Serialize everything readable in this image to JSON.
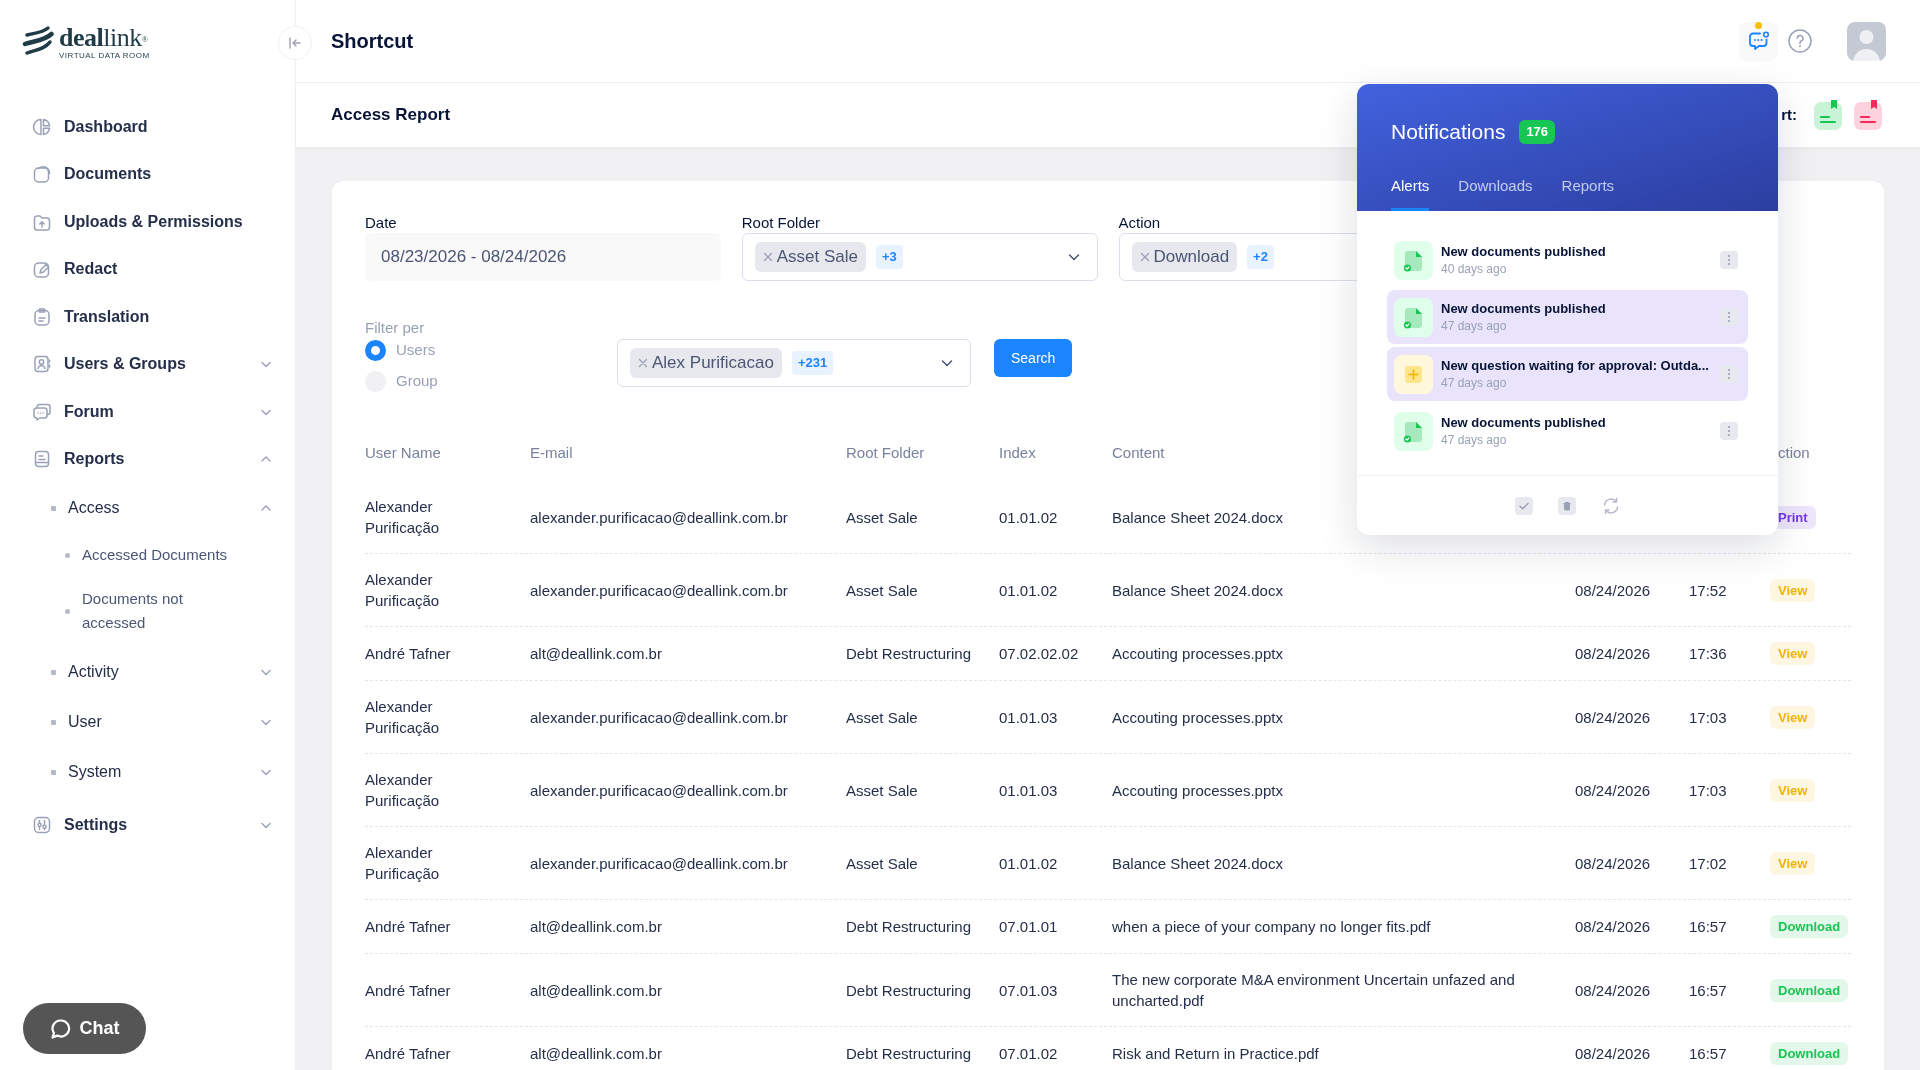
{
  "logo": {
    "wordmark": "**deal**link$^{®}$",
    "tagline": "VIRTUAL DATA ROOM"
  },
  "sidebar": {
    "items": [
      {
        "label": "Dashboard"
      },
      {
        "label": "Documents"
      },
      {
        "label": "Uploads & Permissions"
      },
      {
        "label": "Redact"
      },
      {
        "label": "Translation"
      },
      {
        "label": "Users & Groups",
        "expanded": false
      },
      {
        "label": "Forum",
        "expanded": false
      },
      {
        "label": "Reports",
        "expanded": true,
        "children": [
          {
            "label": "Access",
            "expanded": true,
            "children": [
              {
                "label": "Accessed Documents"
              },
              {
                "label": "Documents not accessed"
              }
            ]
          },
          {
            "label": "Activity",
            "expanded": false
          },
          {
            "label": "User",
            "expanded": false
          },
          {
            "label": "System",
            "expanded": false
          }
        ]
      },
      {
        "label": "Settings",
        "expanded": false
      }
    ],
    "chat_button": "Chat"
  },
  "header": {
    "title": "Shortcut",
    "notification_dot": true
  },
  "subheader": {
    "title": "Access Report",
    "export_label": "rt:"
  },
  "filters": {
    "date": {
      "label": "Date",
      "value": "08/23/2026 - 08/24/2026"
    },
    "root_folder": {
      "label": "Root Folder",
      "chips": [
        "Asset Sale"
      ],
      "more": "+3"
    },
    "action": {
      "label": "Action",
      "chips": [
        "Download"
      ],
      "more": "+2"
    },
    "filter_per": {
      "label": "Filter per",
      "options": [
        {
          "label": "Users",
          "selected": true
        },
        {
          "label": "Group",
          "selected": false
        }
      ]
    },
    "members": {
      "chips": [
        "Alex Purificacao"
      ],
      "more": "+231"
    },
    "search_button": "Search"
  },
  "table": {
    "columns": [
      "User Name",
      "E-mail",
      "Root Folder",
      "Index",
      "Content"
    ],
    "column_8": "ction",
    "rows": [
      {
        "user": "Alexander Purificação",
        "email": "alexander.purificacao@deallink.com.br",
        "root_folder": "Asset Sale",
        "index": "01.01.02",
        "content": "Balance Sheet 2024.docx",
        "action": {
          "label": "Print",
          "color": "#7239ea"
        }
      },
      {
        "user": "Alexander Purificação",
        "email": "alexander.purificacao@deallink.com.br",
        "root_folder": "Asset Sale",
        "index": "01.01.02",
        "content": "Balance Sheet 2024.docx",
        "date": "08/24/2026",
        "time": "17:52",
        "action": {
          "label": "View",
          "color": "#f0b400"
        }
      },
      {
        "user": "André Tafner",
        "email": "alt@deallink.com.br",
        "root_folder": "Debt Restructuring",
        "index": "07.02.02.02",
        "content": "Accouting processes.pptx",
        "date": "08/24/2026",
        "time": "17:36",
        "action": {
          "label": "View",
          "color": "#f0b400"
        }
      },
      {
        "user": "Alexander Purificação",
        "email": "alexander.purificacao@deallink.com.br",
        "root_folder": "Asset Sale",
        "index": "01.01.03",
        "content": "Accouting processes.pptx",
        "date": "08/24/2026",
        "time": "17:03",
        "action": {
          "label": "View",
          "color": "#f0b400"
        }
      },
      {
        "user": "Alexander Purificação",
        "email": "alexander.purificacao@deallink.com.br",
        "root_folder": "Asset Sale",
        "index": "01.01.03",
        "content": "Accouting processes.pptx",
        "date": "08/24/2026",
        "time": "17:03",
        "action": {
          "label": "View",
          "color": "#f0b400"
        }
      },
      {
        "user": "Alexander Purificação",
        "email": "alexander.purificacao@deallink.com.br",
        "root_folder": "Asset Sale",
        "index": "01.01.02",
        "content": "Balance Sheet 2024.docx",
        "date": "08/24/2026",
        "time": "17:02",
        "action": {
          "label": "View",
          "color": "#f0b400"
        }
      },
      {
        "user": "André Tafner",
        "email": "alt@deallink.com.br",
        "root_folder": "Debt Restructuring",
        "index": "07.01.01",
        "content": "when a piece of your company no longer fits.pdf",
        "date": "08/24/2026",
        "time": "16:57",
        "action": {
          "label": "Download",
          "color": "#17c653"
        }
      },
      {
        "user": "André Tafner",
        "email": "alt@deallink.com.br",
        "root_folder": "Debt Restructuring",
        "index": "07.01.03",
        "content": "The new corporate M&A environment Uncertain unfazed and uncharted.pdf",
        "date": "08/24/2026",
        "time": "16:57",
        "action": {
          "label": "Download",
          "color": "#17c653"
        }
      },
      {
        "user": "André Tafner",
        "email": "alt@deallink.com.br",
        "root_folder": "Debt Restructuring",
        "index": "07.01.02",
        "content": "Risk and Return in Practice.pdf",
        "date": "08/24/2026",
        "time": "16:57",
        "action": {
          "label": "Download",
          "color": "#17c653"
        }
      }
    ]
  },
  "notifications": {
    "title": "Notifications",
    "count": "176",
    "tabs": [
      {
        "label": "Alerts",
        "selected": true
      },
      {
        "label": "Downloads",
        "selected": false
      },
      {
        "label": "Reports",
        "selected": false
      }
    ],
    "items": [
      {
        "kind": "document",
        "title": "New documents published",
        "time": "40 days ago",
        "highlighted": false
      },
      {
        "kind": "document",
        "title": "New documents published",
        "time": "47 days ago",
        "highlighted": true
      },
      {
        "kind": "question",
        "title": "New question waiting for approval: Outda...",
        "time": "47 days ago",
        "highlighted": true
      },
      {
        "kind": "document",
        "title": "New documents published",
        "time": "47 days ago",
        "highlighted": false
      }
    ]
  }
}
